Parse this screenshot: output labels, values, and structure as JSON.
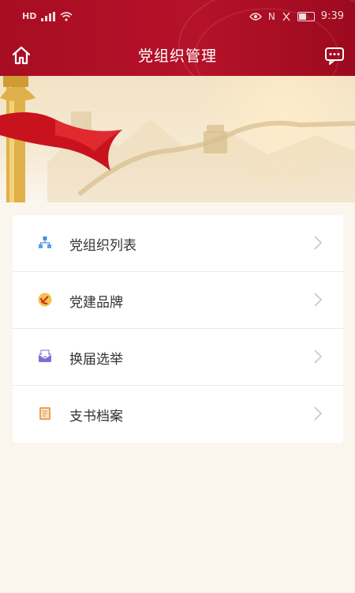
{
  "status_bar": {
    "time": "9:39",
    "left_label": "HD",
    "right_label": "N"
  },
  "header": {
    "title": "党组织管理"
  },
  "menu": {
    "items": [
      {
        "label": "党组织列表",
        "icon": "org-chart-icon"
      },
      {
        "label": "党建品牌",
        "icon": "party-emblem-icon"
      },
      {
        "label": "换届选举",
        "icon": "ballot-envelope-icon"
      },
      {
        "label": "支书档案",
        "icon": "notebook-icon"
      }
    ]
  },
  "colors": {
    "header_red": "#b5122a",
    "page_bg": "#faf6ee"
  }
}
